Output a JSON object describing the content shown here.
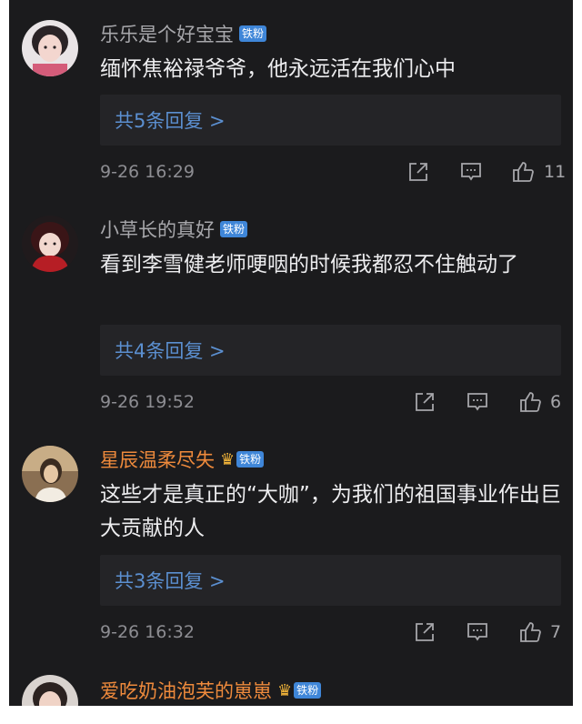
{
  "comments": [
    {
      "username": "乐乐是个好宝宝",
      "badge": "铁粉",
      "text": "缅怀焦裕禄爷爷，他永远活在我们心中",
      "replies": "共5条回复 >",
      "time": "9-26 16:29",
      "likes": "11"
    },
    {
      "username": "小草长的真好",
      "badge": "铁粉",
      "text": "看到李雪健老师哽咽的时候我都忍不住触动了",
      "replies": "共4条回复 >",
      "time": "9-26 19:52",
      "likes": "6"
    },
    {
      "username": "星辰温柔尽失",
      "badge": "铁粉",
      "text": "这些才是真正的“大咖”，为我们的祖国事业作出巨大贡献的人",
      "replies": "共3条回复 >",
      "time": "9-26 16:32",
      "likes": "7"
    },
    {
      "username": "爱吃奶油泡芙的崽崽",
      "badge": "铁粉"
    }
  ],
  "colors": {
    "background": "#1b1b1d",
    "reply_box": "#242427",
    "username_default": "#a7a7ab",
    "username_vip": "#ee8a3c",
    "reply_link": "#5b8fd0",
    "badge": "#3f86d8"
  },
  "icons": [
    "share-icon",
    "comment-icon",
    "thumbs-up-icon",
    "crown-icon"
  ]
}
